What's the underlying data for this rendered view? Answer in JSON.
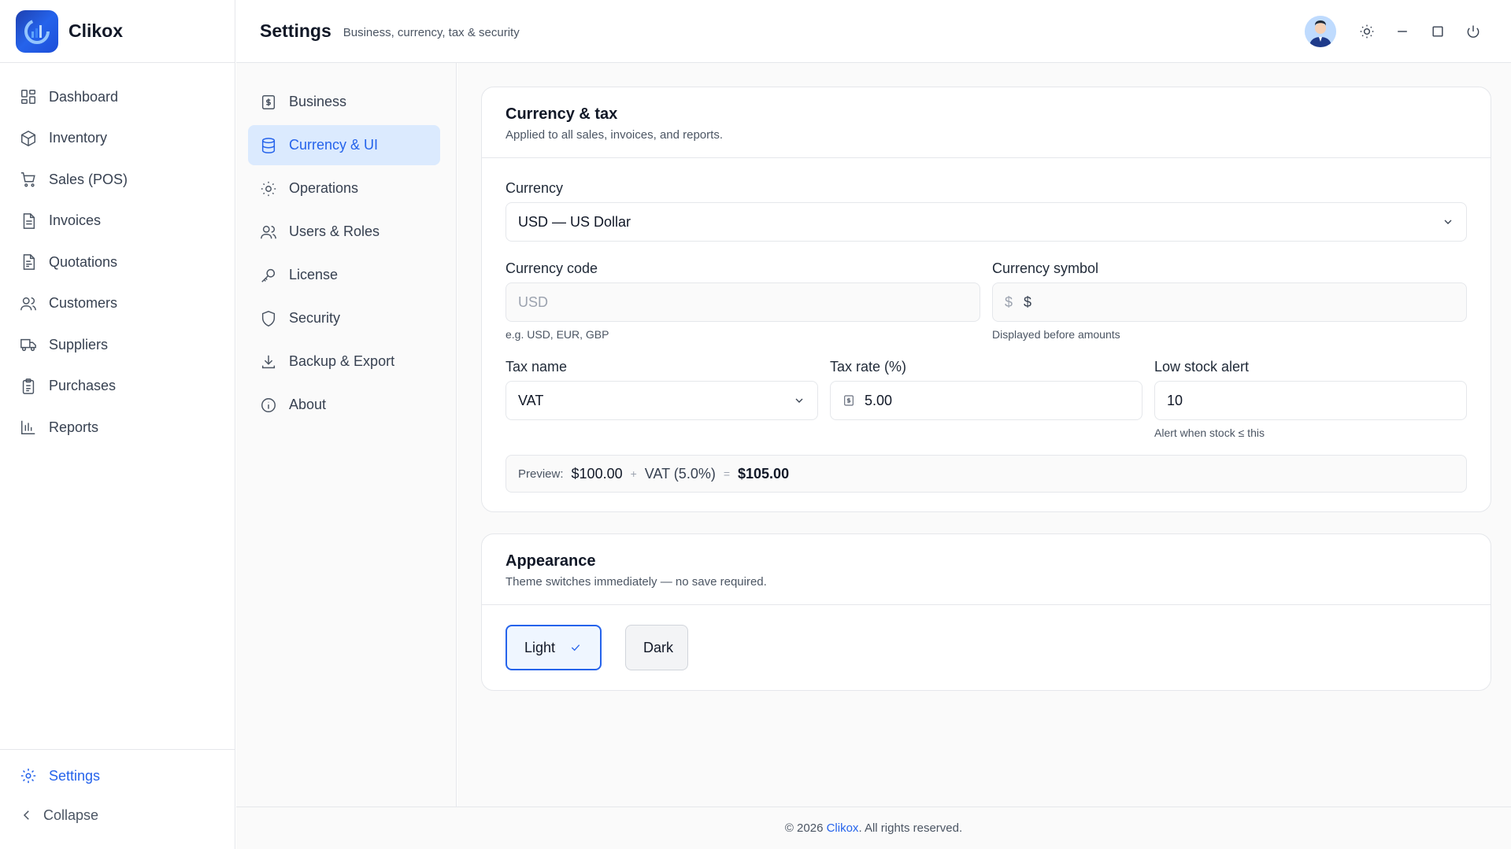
{
  "app": {
    "name": "Clikox"
  },
  "sidebar": {
    "items": [
      {
        "label": "Dashboard",
        "icon": "dashboard-icon"
      },
      {
        "label": "Inventory",
        "icon": "box-icon"
      },
      {
        "label": "Sales (POS)",
        "icon": "cart-icon"
      },
      {
        "label": "Invoices",
        "icon": "document-icon"
      },
      {
        "label": "Quotations",
        "icon": "quote-icon"
      },
      {
        "label": "Customers",
        "icon": "users-icon"
      },
      {
        "label": "Suppliers",
        "icon": "truck-icon"
      },
      {
        "label": "Purchases",
        "icon": "clipboard-icon"
      },
      {
        "label": "Reports",
        "icon": "bar-chart-icon"
      }
    ],
    "settings_label": "Settings",
    "collapse_label": "Collapse"
  },
  "header": {
    "title": "Settings",
    "subtitle": "Business, currency, tax & security"
  },
  "settings_menu": {
    "items": [
      {
        "label": "Business",
        "icon": "receipt-icon"
      },
      {
        "label": "Currency & UI",
        "icon": "database-icon",
        "active": true
      },
      {
        "label": "Operations",
        "icon": "sun-icon"
      },
      {
        "label": "Users & Roles",
        "icon": "users-icon"
      },
      {
        "label": "License",
        "icon": "key-icon"
      },
      {
        "label": "Security",
        "icon": "shield-icon"
      },
      {
        "label": "Backup & Export",
        "icon": "download-icon"
      },
      {
        "label": "About",
        "icon": "info-icon"
      }
    ]
  },
  "currency_card": {
    "title": "Currency & tax",
    "description": "Applied to all sales, invoices, and reports.",
    "currency": {
      "label": "Currency",
      "value": "USD — US Dollar"
    },
    "currency_code": {
      "label": "Currency code",
      "placeholder": "USD",
      "hint": "e.g. USD, EUR, GBP"
    },
    "currency_symbol": {
      "label": "Currency symbol",
      "prefix": "$",
      "value": "$",
      "hint": "Displayed before amounts"
    },
    "tax_name": {
      "label": "Tax name",
      "value": "VAT"
    },
    "tax_rate": {
      "label": "Tax rate (%)",
      "value": "5.00"
    },
    "low_stock": {
      "label": "Low stock alert",
      "value": "10",
      "hint": "Alert when stock ≤ this"
    },
    "preview": {
      "label": "Preview:",
      "amount": "$100.00",
      "plus": "+",
      "tax": "VAT (5.0%)",
      "equals": "=",
      "total": "$105.00"
    }
  },
  "appearance_card": {
    "title": "Appearance",
    "description": "Theme switches immediately — no save required.",
    "light_label": "Light",
    "dark_label": "Dark",
    "selected": "Light"
  },
  "footer": {
    "copyright": "© 2026",
    "brand": "Clikox",
    "rights": ". All rights reserved."
  },
  "colors": {
    "accent": "#2563eb",
    "active_bg": "#dbeafe"
  }
}
